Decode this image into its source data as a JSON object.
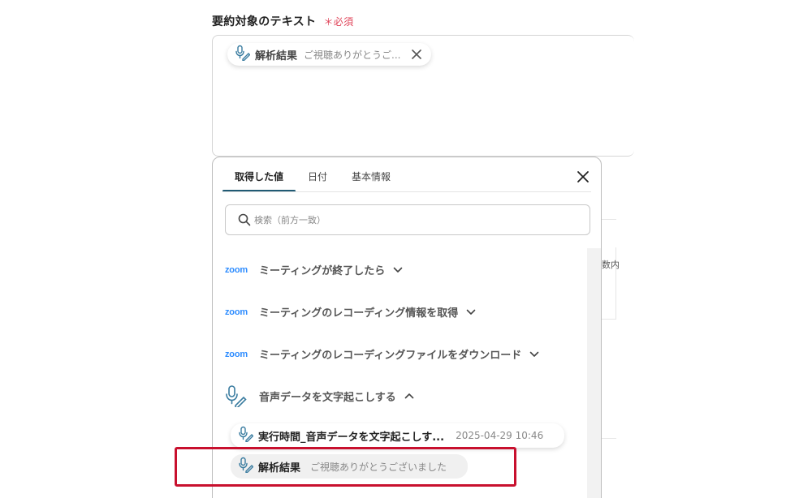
{
  "field": {
    "label": "要約対象のテキスト",
    "required_mark": "＊",
    "required_text": "必須"
  },
  "textarea_chip": {
    "name": "解析結果",
    "value": "ご視聴ありがとうご...",
    "icon": "microphone-pen-icon"
  },
  "background": {
    "side_text": "数内"
  },
  "popup": {
    "tabs": [
      {
        "label": "取得した値",
        "active": true
      },
      {
        "label": "日付",
        "active": false
      },
      {
        "label": "基本情報",
        "active": false
      }
    ],
    "search_placeholder": "検索（前方一致）",
    "groups": [
      {
        "logo": "zoom",
        "label": "ミーティングが終了したら",
        "expanded": false
      },
      {
        "logo": "zoom",
        "label": "ミーティングのレコーディング情報を取得",
        "expanded": false
      },
      {
        "logo": "zoom",
        "label": "ミーティングのレコーディングファイルをダウンロード",
        "expanded": false
      },
      {
        "logo": "microphone-pen-icon",
        "label": "音声データを文字起こしする",
        "expanded": true
      }
    ],
    "items": [
      {
        "name": "実行時間_音声データを文字起こしす...",
        "value": "2025-04-29 10:46"
      },
      {
        "name": "解析結果",
        "value": "ご視聴ありがとうございました"
      }
    ]
  },
  "colors": {
    "accent": "#205a74",
    "zoom_blue": "#2d8cff",
    "required_red": "#e0455a",
    "highlight_red": "#c8102e"
  }
}
